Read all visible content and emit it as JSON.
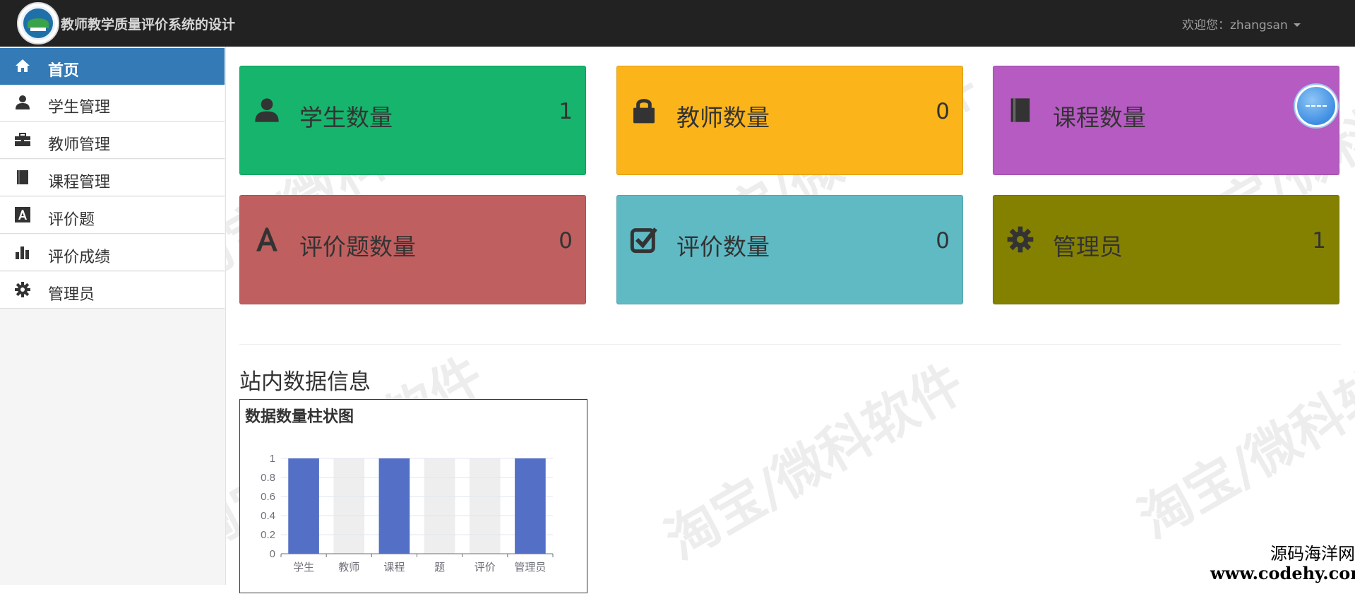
{
  "app": {
    "title": "教师教学质量评价系统的设计",
    "user_greeting": "欢迎您：zhangsan"
  },
  "sidebar": {
    "items": [
      {
        "label": "首页",
        "icon": "home-icon",
        "active": true
      },
      {
        "label": "学生管理",
        "icon": "user-icon",
        "active": false
      },
      {
        "label": "教师管理",
        "icon": "briefcase-icon",
        "active": false
      },
      {
        "label": "课程管理",
        "icon": "book-icon",
        "active": false
      },
      {
        "label": "评价题",
        "icon": "font-icon",
        "active": false
      },
      {
        "label": "评价成绩",
        "icon": "stats-icon",
        "active": false
      },
      {
        "label": "管理员",
        "icon": "cog-icon",
        "active": false
      }
    ]
  },
  "cards": [
    {
      "label": "学生数量",
      "count": "1",
      "icon": "user-icon",
      "color": "#16b46c"
    },
    {
      "label": "教师数量",
      "count": "0",
      "icon": "lock-icon",
      "color": "#fbb41a"
    },
    {
      "label": "课程数量",
      "count": "",
      "icon": "book-icon",
      "color": "#b55bc1"
    },
    {
      "label": "评价题数量",
      "count": "0",
      "icon": "font-icon",
      "color": "#c05f5f"
    },
    {
      "label": "评价数量",
      "count": "0",
      "icon": "check-icon",
      "color": "#5fbac4"
    },
    {
      "label": "管理员",
      "count": "1",
      "icon": "cog-icon",
      "color": "#858100"
    }
  ],
  "section": {
    "title": "站内数据信息"
  },
  "chart_data": {
    "type": "bar",
    "title": "数据数量柱状图",
    "categories": [
      "学生",
      "教师",
      "课程",
      "题",
      "评价",
      "管理员"
    ],
    "values": [
      1,
      0,
      1,
      0,
      0,
      1
    ],
    "ylim": [
      0,
      1
    ],
    "yticks": [
      0,
      0.2,
      0.4,
      0.6,
      0.8,
      1
    ],
    "ytick_labels": [
      "0",
      "0.2",
      "0.4",
      "0.6",
      "0.8",
      "1"
    ],
    "bar_color": "#5470c6",
    "background_bar_color": "#eeeeee",
    "grid": true
  },
  "watermark": {
    "text": "淘宝/微科软件"
  },
  "corner_brand": {
    "name": "源码海洋网",
    "url": "www.codehy.com"
  }
}
